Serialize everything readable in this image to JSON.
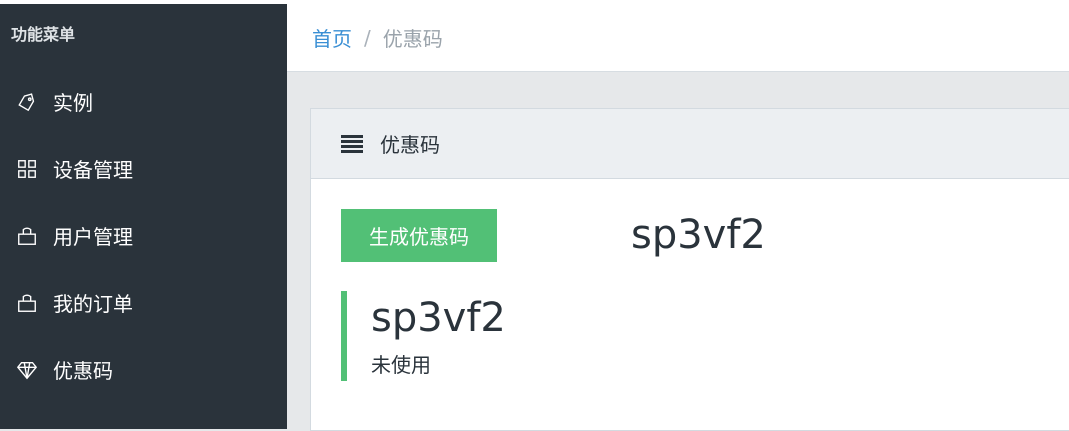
{
  "sidebar": {
    "header": "功能菜单",
    "items": [
      {
        "label": "实例",
        "icon": "tag-icon"
      },
      {
        "label": "设备管理",
        "icon": "grid-icon"
      },
      {
        "label": "用户管理",
        "icon": "bag-icon"
      },
      {
        "label": "我的订单",
        "icon": "bag-icon"
      },
      {
        "label": "优惠码",
        "icon": "diamond-icon"
      }
    ]
  },
  "breadcrumb": {
    "home": "首页",
    "separator": "/",
    "current": "优惠码"
  },
  "card": {
    "title": "优惠码",
    "generate_button": "生成优惠码",
    "generated_code": "sp3vf2",
    "codes": [
      {
        "code": "sp3vf2",
        "status": "未使用"
      }
    ]
  },
  "colors": {
    "sidebar_bg": "#2a333b",
    "accent_green": "#52c076",
    "link_blue": "#3a8fd4"
  }
}
